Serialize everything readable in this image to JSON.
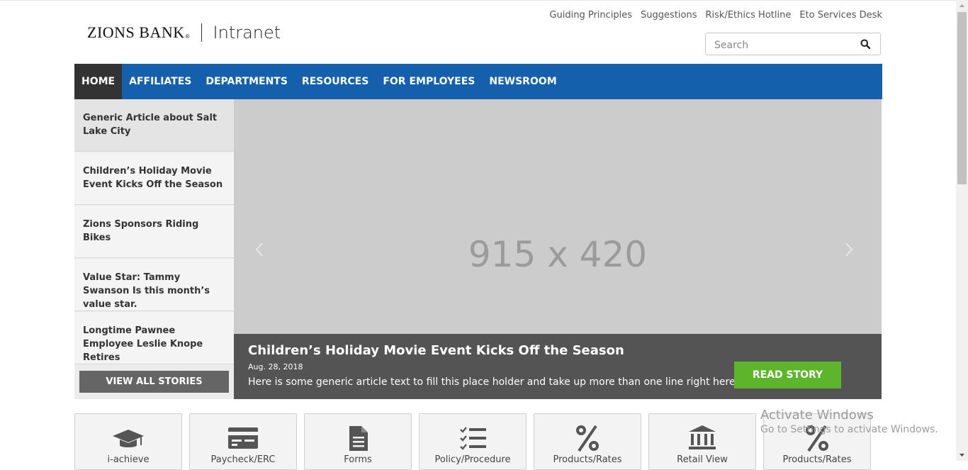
{
  "header": {
    "brand": "ZIONS BANK",
    "brand_mark": "®",
    "site_name": "Intranet",
    "utility_links": [
      "Guiding Principles",
      "Suggestions",
      "Risk/Ethics Hotline",
      "Eto Services Desk"
    ],
    "search_placeholder": "Search"
  },
  "nav": {
    "items": [
      "HOME",
      "AFFILIATES",
      "DEPARTMENTS",
      "RESOURCES",
      "FOR EMPLOYEES",
      "NEWSROOM"
    ],
    "active": "HOME",
    "color": "#1560ac"
  },
  "stories": {
    "items": [
      "Generic Article about Salt Lake City",
      "Children’s Holiday Movie Event Kicks Off the Season",
      "Zions Sponsors Riding Bikes",
      "Value Star: Tammy Swanson Is this month’s value star.",
      "Longtime Pawnee Employee Leslie Knope Retires"
    ],
    "view_all": "VIEW ALL STORIES"
  },
  "carousel": {
    "placeholder": "915 x 420",
    "title": "Children’s Holiday Movie Event Kicks Off the Season",
    "date": "Aug. 28, 2018",
    "text": "Here is some generic article text to fill this place holder and take up more than one line right here.",
    "button": "READ STORY",
    "button_color": "#5db52b"
  },
  "quick_links": [
    {
      "label": "i-achieve",
      "icon": "graduation-cap-icon"
    },
    {
      "label": "Paycheck/ERC",
      "icon": "credit-card-icon"
    },
    {
      "label": "Forms",
      "icon": "document-icon"
    },
    {
      "label": "Policy/Procedure",
      "icon": "checklist-icon"
    },
    {
      "label": "Products/Rates",
      "icon": "percent-icon"
    },
    {
      "label": "Retail View",
      "icon": "bank-icon"
    },
    {
      "label": "Products/Rates",
      "icon": "percent-icon"
    }
  ],
  "watermark": {
    "line1": "Activate Windows",
    "line2": "Go to Settings to activate Windows."
  }
}
